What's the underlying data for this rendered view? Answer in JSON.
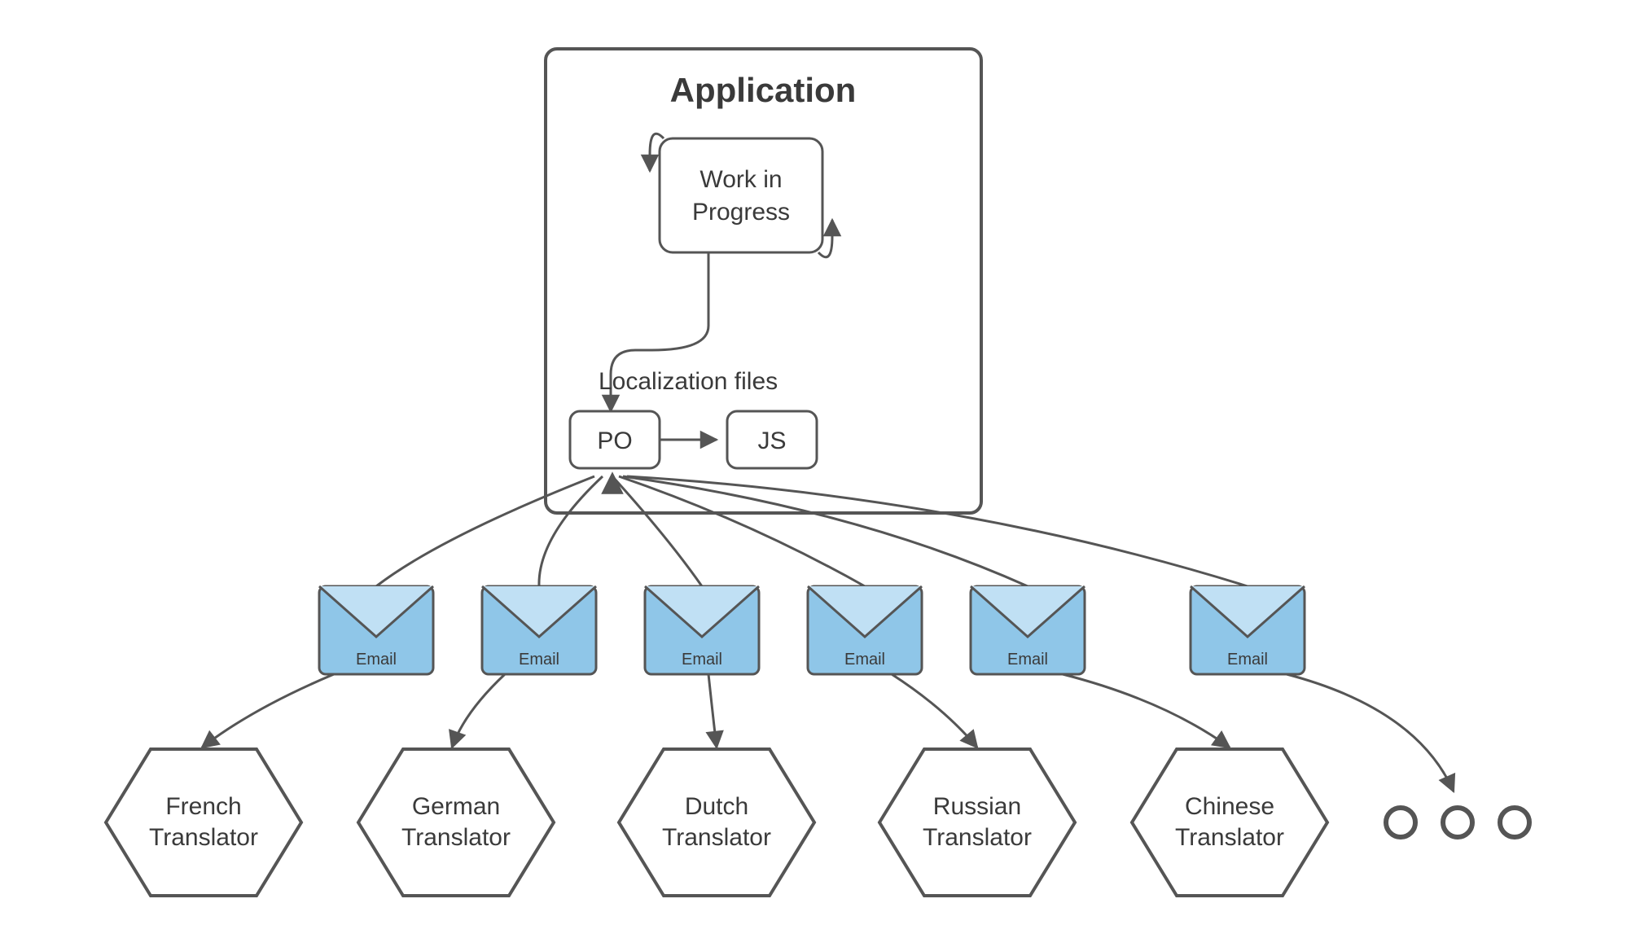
{
  "application": {
    "title": "Application",
    "work_in_progress": {
      "line1": "Work in",
      "line2": "Progress"
    },
    "localization_label": "Localization files",
    "po_label": "PO",
    "js_label": "JS"
  },
  "emails": [
    {
      "label": "Email"
    },
    {
      "label": "Email"
    },
    {
      "label": "Email"
    },
    {
      "label": "Email"
    },
    {
      "label": "Email"
    },
    {
      "label": "Email"
    }
  ],
  "translators": [
    {
      "line1": "French",
      "line2": "Translator"
    },
    {
      "line1": "German",
      "line2": "Translator"
    },
    {
      "line1": "Dutch",
      "line2": "Translator"
    },
    {
      "line1": "Russian",
      "line2": "Translator"
    },
    {
      "line1": "Chinese",
      "line2": "Translator"
    }
  ]
}
